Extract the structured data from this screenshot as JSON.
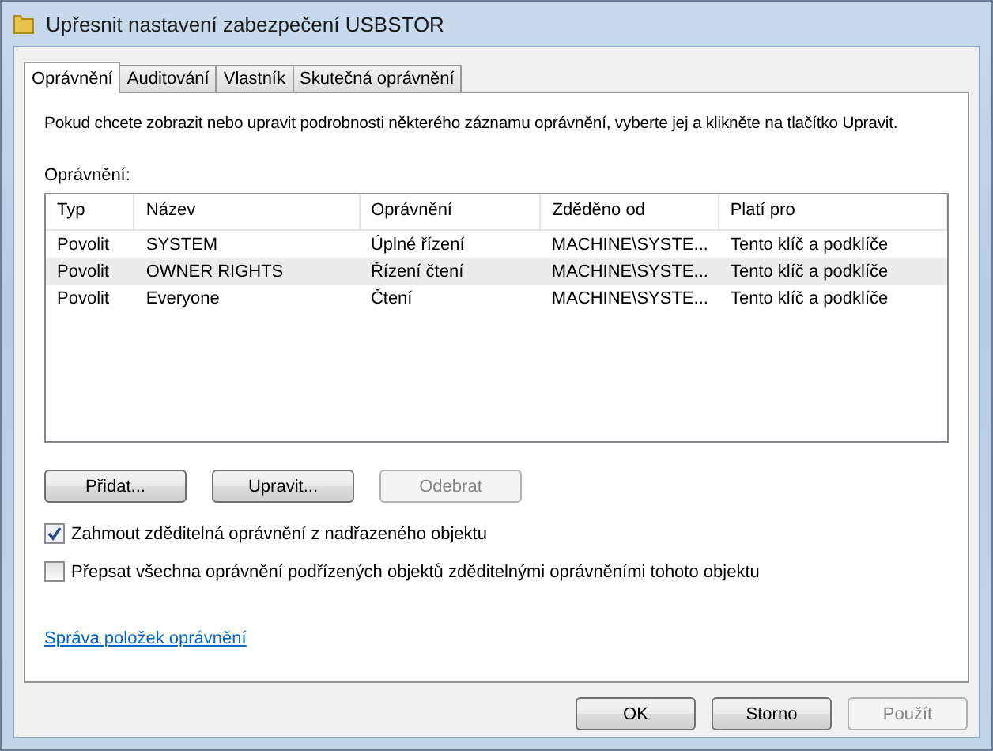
{
  "window": {
    "title": "Upřesnit nastavení zabezpečení USBSTOR"
  },
  "tabs": [
    {
      "label": "Oprávnění",
      "selected": true
    },
    {
      "label": "Auditování",
      "selected": false
    },
    {
      "label": "Vlastník",
      "selected": false
    },
    {
      "label": "Skutečná oprávnění",
      "selected": false
    }
  ],
  "intro": "Pokud chcete zobrazit nebo upravit podrobnosti některého záznamu oprávnění, vyberte jej a klikněte na tlačítko Upravit.",
  "table": {
    "label": "Oprávnění:",
    "columns": [
      "Typ",
      "Název",
      "Oprávnění",
      "Zděděno od",
      "Platí pro"
    ],
    "rows": [
      {
        "cells": [
          "Povolit",
          "SYSTEM",
          "Úplné řízení",
          "MACHINE\\SYSTE...",
          "Tento klíč a podklíče"
        ],
        "selected": false
      },
      {
        "cells": [
          "Povolit",
          "OWNER RIGHTS",
          "Řízení čtení",
          "MACHINE\\SYSTE...",
          "Tento klíč a podklíče"
        ],
        "selected": true
      },
      {
        "cells": [
          "Povolit",
          "Everyone",
          "Čtení",
          "MACHINE\\SYSTE...",
          "Tento klíč a podklíče"
        ],
        "selected": false
      }
    ]
  },
  "actions": [
    {
      "label": "Přidat...",
      "disabled": false
    },
    {
      "label": "Upravit...",
      "disabled": false
    },
    {
      "label": "Odebrat",
      "disabled": true
    }
  ],
  "options": [
    {
      "label": "Zahmout zděditelná oprávnění z nadřazeného objektu",
      "checked": true
    },
    {
      "label": "Přepsat všechna oprávnění podřízených objektů zděditelnými oprávněními tohoto objektu",
      "checked": false
    }
  ],
  "link": "Správa položek oprávnění",
  "buttons": [
    {
      "label": "OK",
      "disabled": false
    },
    {
      "label": "Storno",
      "disabled": false
    },
    {
      "label": "Použít",
      "disabled": true
    }
  ]
}
